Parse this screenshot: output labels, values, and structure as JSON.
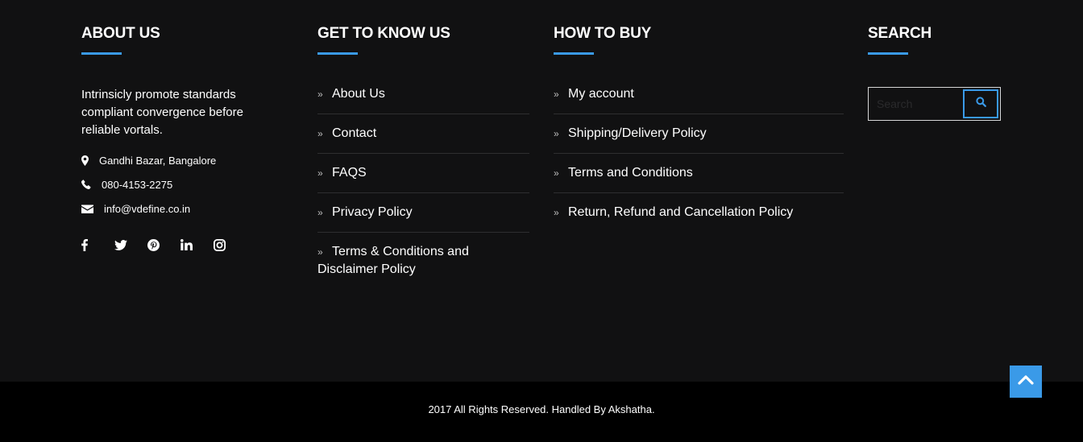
{
  "about": {
    "title": "ABOUT US",
    "text": "Intrinsicly promote standards compliant convergence before reliable vortals.",
    "address": "Gandhi Bazar, Bangalore",
    "phone": "080-4153-2275",
    "email": "info@vdefine.co.in",
    "socials": [
      "facebook-icon",
      "twitter-icon",
      "pinterest-icon",
      "linkedin-icon",
      "instagram-icon"
    ]
  },
  "know": {
    "title": "GET TO KNOW US",
    "links": [
      "About Us",
      "Contact",
      "FAQS",
      "Privacy Policy",
      "Terms & Conditions and Disclaimer Policy"
    ]
  },
  "buy": {
    "title": "HOW TO BUY",
    "links": [
      "My account",
      "Shipping/Delivery Policy",
      "Terms and Conditions",
      "Return, Refund and Cancellation Policy"
    ]
  },
  "search": {
    "title": "SEARCH",
    "placeholder": "Search"
  },
  "footer": {
    "copyright": "2017 All Rights Reserved. Handled By Akshatha."
  },
  "colors": {
    "accent": "#3a9ae8",
    "background": "#111112",
    "bottom_bar": "#000000"
  }
}
